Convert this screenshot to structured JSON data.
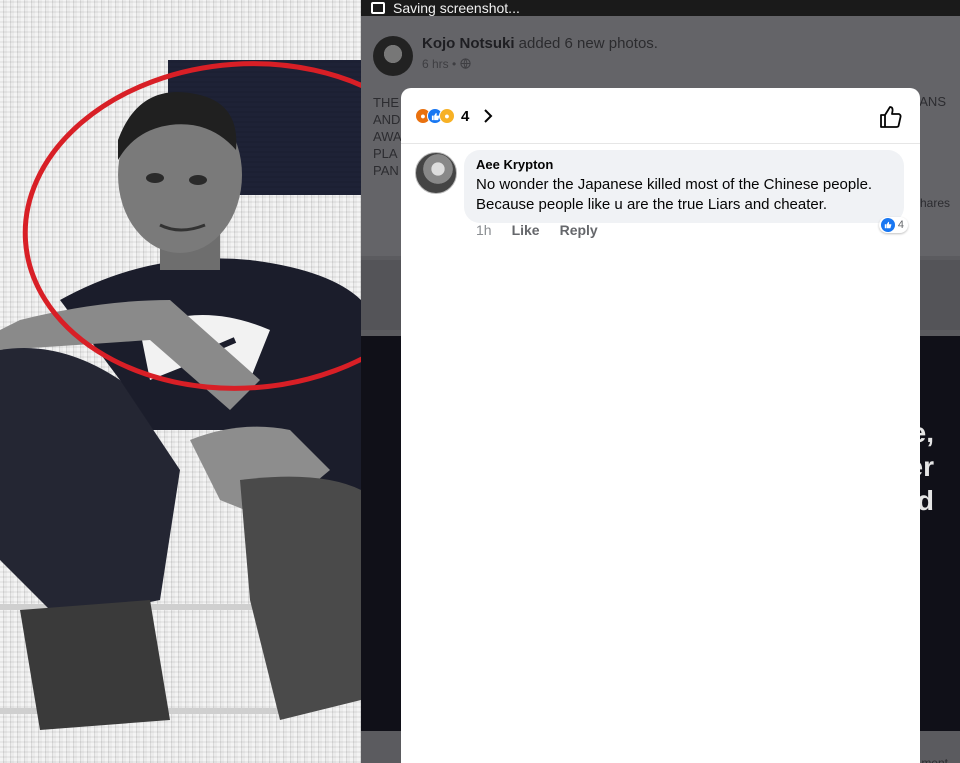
{
  "statusbar": {
    "text": "Saving screenshot..."
  },
  "post": {
    "author": "Kojo Notsuki",
    "action": "added 6 new photos.",
    "time": "6 hrs",
    "text_left": "THE\nAND\nAWA\nPLA\nPAN",
    "text_right": "ANS",
    "shares_label": "hares",
    "video_text": "e,\ner\nd",
    "bottom_label": "ment"
  },
  "modal": {
    "reaction_count": "4",
    "reactions": [
      "angry",
      "like",
      "sad"
    ]
  },
  "comment": {
    "author": "Aee Krypton",
    "text": "No wonder the Japanese killed most of the Chinese people. Because people like u are the true Liars and cheater.",
    "time": "1h",
    "like_label": "Like",
    "reply_label": "Reply",
    "like_count": "4"
  },
  "colors": {
    "accent": "#1877f2",
    "annotation_circle": "#d81f26",
    "modal_bg": "#ffffff",
    "bubble_bg": "#f0f2f5"
  },
  "icons": [
    "screenshot-icon",
    "globe-icon",
    "like-outline-icon",
    "chevron-right-icon",
    "thumbs-up-icon"
  ]
}
